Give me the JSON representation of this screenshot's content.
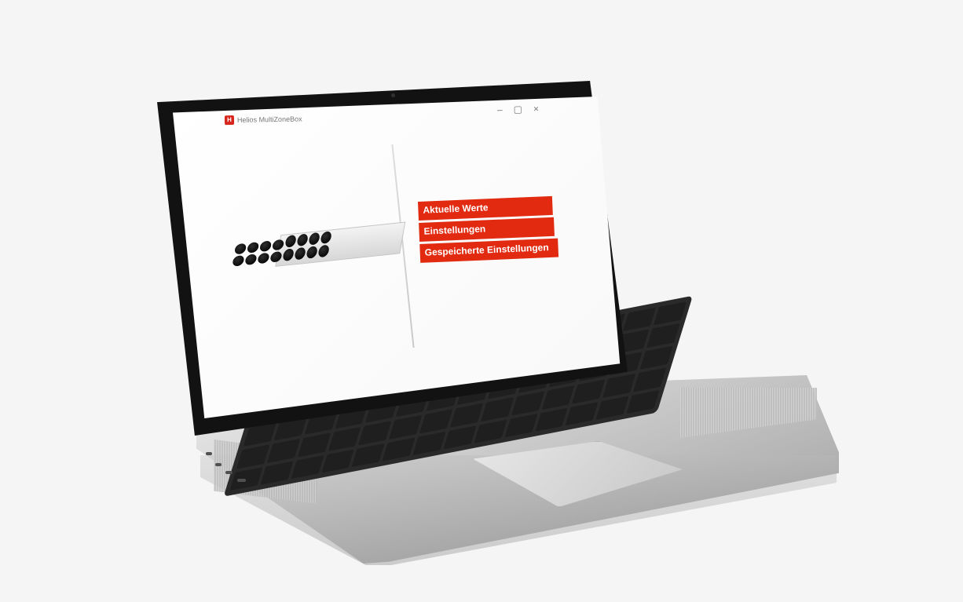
{
  "app": {
    "title": "Helios MultiZoneBox",
    "logo_text": "H"
  },
  "window_controls": {
    "minimize": "–",
    "maximize": "▢",
    "close": "×"
  },
  "menu": {
    "items": [
      {
        "label": "Aktuelle Werte"
      },
      {
        "label": "Einstellungen"
      },
      {
        "label": "Gespeicherte Einstellungen"
      }
    ]
  },
  "colors": {
    "brand": "#d7261d",
    "button": "#e22a11"
  },
  "icons": {
    "logo": "helios-logo-icon",
    "minimize": "minimize-icon",
    "maximize": "maximize-icon",
    "close": "close-icon"
  }
}
